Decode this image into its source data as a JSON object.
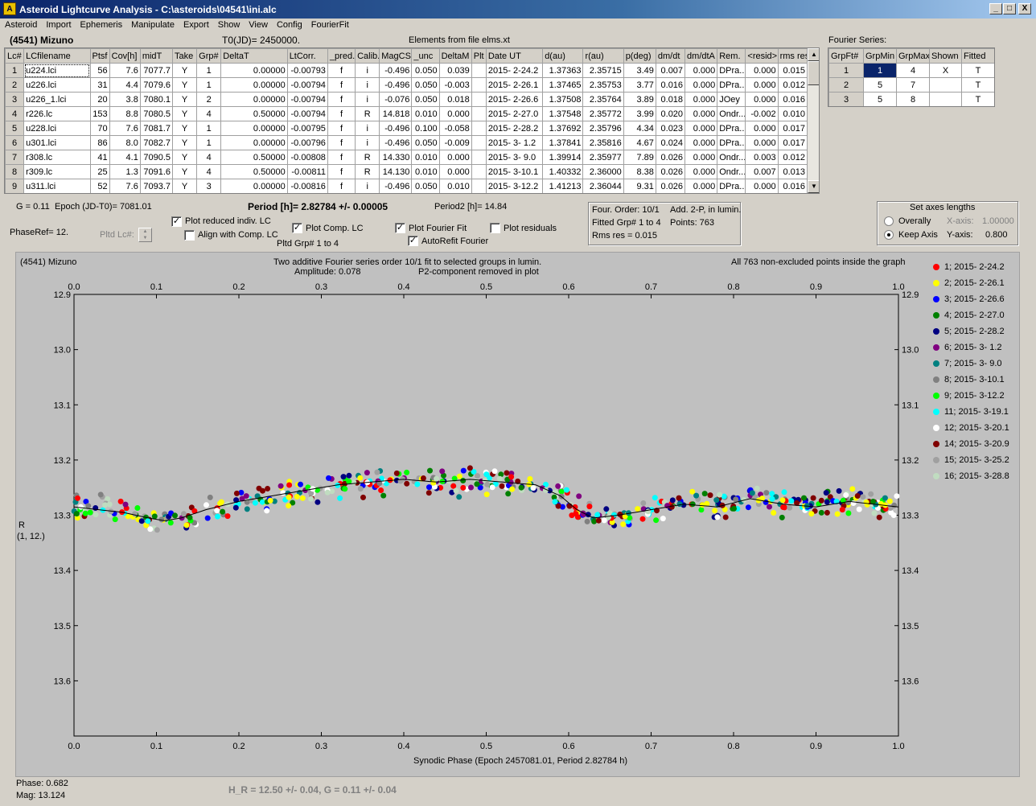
{
  "window": {
    "title": "Asteroid Lightcurve Analysis - C:\\asteroids\\04541\\ini.alc",
    "app_icon": "ALCDEF-app-icon",
    "min_label": "_",
    "max_label": "□",
    "close_label": "X"
  },
  "menu": [
    "Asteroid",
    "Import",
    "Ephemeris",
    "Manipulate",
    "Export",
    "Show",
    "View",
    "Config",
    "FourierFit"
  ],
  "header": {
    "asteroid": "(4541) Mizuno",
    "t0": "T0(JD)= 2450000.",
    "elements": "Elements from file elms.xt"
  },
  "lc_table": {
    "columns": [
      "Lc#",
      "LCfilename",
      "Ptsf",
      "Cov[h]",
      "midT",
      "Take",
      "Grp#",
      "DeltaT",
      "LtCorr.",
      "_pred.",
      "Calib.",
      "MagCS",
      "_unc",
      "DeltaM",
      "Plt",
      "Date UT",
      "d(au)",
      "r(au)",
      "p(deg)",
      "dm/dt",
      "dm/dtA",
      "Rem.",
      "<resid>",
      "rms res"
    ],
    "rows": [
      [
        "1",
        "u224.lci",
        "56",
        "7.6",
        "7077.7",
        "Y",
        "1",
        "0.00000",
        "-0.00793",
        "f",
        "i",
        "-0.496",
        "0.050",
        "0.039",
        "",
        "2015- 2-24.2",
        "1.37363",
        "2.35715",
        "3.49",
        "0.007",
        "0.000",
        "DPra...",
        "0.000",
        "0.015"
      ],
      [
        "2",
        "u226.lci",
        "31",
        "4.4",
        "7079.6",
        "Y",
        "1",
        "0.00000",
        "-0.00794",
        "f",
        "i",
        "-0.496",
        "0.050",
        "-0.003",
        "",
        "2015- 2-26.1",
        "1.37465",
        "2.35753",
        "3.77",
        "0.016",
        "0.000",
        "DPra...",
        "0.000",
        "0.012"
      ],
      [
        "3",
        "u226_1.lci",
        "20",
        "3.8",
        "7080.1",
        "Y",
        "2",
        "0.00000",
        "-0.00794",
        "f",
        "i",
        "-0.076",
        "0.050",
        "0.018",
        "",
        "2015- 2-26.6",
        "1.37508",
        "2.35764",
        "3.89",
        "0.018",
        "0.000",
        "JOey",
        "0.000",
        "0.016"
      ],
      [
        "4",
        "r226.lc",
        "153",
        "8.8",
        "7080.5",
        "Y",
        "4",
        "0.50000",
        "-0.00794",
        "f",
        "R",
        "14.818",
        "0.010",
        "0.000",
        "",
        "2015- 2-27.0",
        "1.37548",
        "2.35772",
        "3.99",
        "0.020",
        "0.000",
        "Ondr...",
        "-0.002",
        "0.010"
      ],
      [
        "5",
        "u228.lci",
        "70",
        "7.6",
        "7081.7",
        "Y",
        "1",
        "0.00000",
        "-0.00795",
        "f",
        "i",
        "-0.496",
        "0.100",
        "-0.058",
        "",
        "2015- 2-28.2",
        "1.37692",
        "2.35796",
        "4.34",
        "0.023",
        "0.000",
        "DPra...",
        "0.000",
        "0.017"
      ],
      [
        "6",
        "u301.lci",
        "86",
        "8.0",
        "7082.7",
        "Y",
        "1",
        "0.00000",
        "-0.00796",
        "f",
        "i",
        "-0.496",
        "0.050",
        "-0.009",
        "",
        "2015- 3- 1.2",
        "1.37841",
        "2.35816",
        "4.67",
        "0.024",
        "0.000",
        "DPra...",
        "0.000",
        "0.017"
      ],
      [
        "7",
        "r308.lc",
        "41",
        "4.1",
        "7090.5",
        "Y",
        "4",
        "0.50000",
        "-0.00808",
        "f",
        "R",
        "14.330",
        "0.010",
        "0.000",
        "",
        "2015- 3- 9.0",
        "1.39914",
        "2.35977",
        "7.89",
        "0.026",
        "0.000",
        "Ondr...",
        "0.003",
        "0.012"
      ],
      [
        "8",
        "r309.lc",
        "25",
        "1.3",
        "7091.6",
        "Y",
        "4",
        "0.50000",
        "-0.00811",
        "f",
        "R",
        "14.130",
        "0.010",
        "0.000",
        "",
        "2015- 3-10.1",
        "1.40332",
        "2.36000",
        "8.38",
        "0.026",
        "0.000",
        "Ondr...",
        "0.007",
        "0.013"
      ],
      [
        "9",
        "u311.lci",
        "52",
        "7.6",
        "7093.7",
        "Y",
        "3",
        "0.00000",
        "-0.00816",
        "f",
        "i",
        "-0.496",
        "0.050",
        "0.010",
        "",
        "2015- 3-12.2",
        "1.41213",
        "2.36044",
        "9.31",
        "0.026",
        "0.000",
        "DPra...",
        "0.000",
        "0.016"
      ]
    ]
  },
  "fourier_series": {
    "title": "Fourier Series:",
    "columns": [
      "GrpFt#",
      "GrpMin",
      "GrpMax",
      "Shown",
      "Fitted"
    ],
    "rows": [
      [
        "1",
        "1",
        "4",
        "X",
        "T"
      ],
      [
        "2",
        "5",
        "7",
        "",
        "T"
      ],
      [
        "3",
        "5",
        "8",
        "",
        "T"
      ]
    ]
  },
  "params": {
    "g": "G = 0.11",
    "epoch": "Epoch (JD-T0)= 7081.01",
    "period": "Period [h]= 2.82784 +/- 0.00005",
    "period2": "Period2 [h]= 14.84",
    "phaseref": "PhaseRef= 12.",
    "pltd_lc": "Pltd Lc#:",
    "pltd_grp": "Pltd Grp#  1   to   4"
  },
  "options": {
    "plot_reduced": {
      "label": "Plot reduced indiv. LC",
      "checked": true
    },
    "align_comp": {
      "label": "Align with Comp. LC",
      "checked": false
    },
    "plot_comp": {
      "label": "Plot Comp. LC",
      "checked": true
    },
    "plot_fourier": {
      "label": "Plot Fourier Fit",
      "checked": true
    },
    "autorefit": {
      "label": "AutoRefit Fourier",
      "checked": true
    },
    "plot_residuals": {
      "label": "Plot residuals",
      "checked": false
    }
  },
  "fit_info": {
    "order": "Four. Order: 10/1",
    "add": "Add. 2-P, in lumin.",
    "fitted": "Fitted Grp# 1 to 4",
    "points": "Points: 763",
    "rms": "Rms res     = 0.015"
  },
  "axes_box": {
    "title": "Set axes lengths",
    "overally": "Overally",
    "keep_axis": "Keep Axis",
    "xaxis_label": "X-axis:",
    "xaxis_value": "1.00000",
    "yaxis_label": "Y-axis:",
    "yaxis_value": "0.800",
    "selected": "Keep Axis"
  },
  "plot": {
    "name": "(4541) Mizuno",
    "line1": "Two additive Fourier series order 10/1 fit to selected groups in lumin.",
    "amplitude": "Amplitude: 0.078",
    "p2": "P2-component removed in plot",
    "note": "All 763 non-excluded points inside the graph",
    "ylabel1": "R",
    "ylabel2": "(1, 12.)",
    "xlabel": "Synodic Phase (Epoch 2457081.01, Period 2.82784 h)"
  },
  "chart_data": {
    "type": "scatter",
    "xlim": [
      0.0,
      1.0
    ],
    "ylim": [
      13.7,
      12.9
    ],
    "y_inverted": true,
    "x_ticks": [
      "0.0",
      "0.1",
      "0.2",
      "0.3",
      "0.4",
      "0.5",
      "0.6",
      "0.7",
      "0.8",
      "0.9",
      "1.0"
    ],
    "y_ticks": [
      "12.9",
      "13.0",
      "13.1",
      "13.2",
      "13.3",
      "13.4",
      "13.5",
      "13.6"
    ],
    "fourier_curve": {
      "x": [
        0.0,
        0.03,
        0.06,
        0.09,
        0.11,
        0.13,
        0.16,
        0.2,
        0.24,
        0.28,
        0.32,
        0.36,
        0.4,
        0.44,
        0.48,
        0.52,
        0.56,
        0.59,
        0.61,
        0.63,
        0.66,
        0.7,
        0.74,
        0.78,
        0.82,
        0.86,
        0.9,
        0.94,
        0.97,
        1.0
      ],
      "y": [
        13.285,
        13.29,
        13.295,
        13.305,
        13.31,
        13.305,
        13.29,
        13.275,
        13.265,
        13.255,
        13.245,
        13.24,
        13.235,
        13.24,
        13.235,
        13.24,
        13.245,
        13.265,
        13.29,
        13.305,
        13.3,
        13.29,
        13.28,
        13.285,
        13.27,
        13.28,
        13.285,
        13.275,
        13.28,
        13.285
      ]
    },
    "series": [
      {
        "name": "1; 2015- 2-24.2",
        "color": "#ff0000"
      },
      {
        "name": "2; 2015- 2-26.1",
        "color": "#ffff00"
      },
      {
        "name": "3; 2015- 2-26.6",
        "color": "#0000ff"
      },
      {
        "name": "4; 2015- 2-27.0",
        "color": "#008000"
      },
      {
        "name": "5; 2015- 2-28.2",
        "color": "#000080"
      },
      {
        "name": "6; 2015- 3- 1.2",
        "color": "#800080"
      },
      {
        "name": "7; 2015- 3- 9.0",
        "color": "#008080"
      },
      {
        "name": "8; 2015- 3-10.1",
        "color": "#808080"
      },
      {
        "name": "9; 2015- 3-12.2",
        "color": "#00ff00"
      },
      {
        "name": "11; 2015- 3-19.1",
        "color": "#00ffff"
      },
      {
        "name": "12; 2015- 3-20.1",
        "color": "#ffffff"
      },
      {
        "name": "14; 2015- 3-20.9",
        "color": "#800000"
      },
      {
        "name": "15; 2015- 3-25.2",
        "color": "#a0a0a0"
      },
      {
        "name": "16; 2015- 3-28.8",
        "color": "#c0dcc0"
      }
    ]
  },
  "status": {
    "phase": "Phase:  0.682",
    "mag": "Mag:    13.124",
    "hr": "H_R = 12.50 +/- 0.04, G = 0.11 +/- 0.04"
  }
}
